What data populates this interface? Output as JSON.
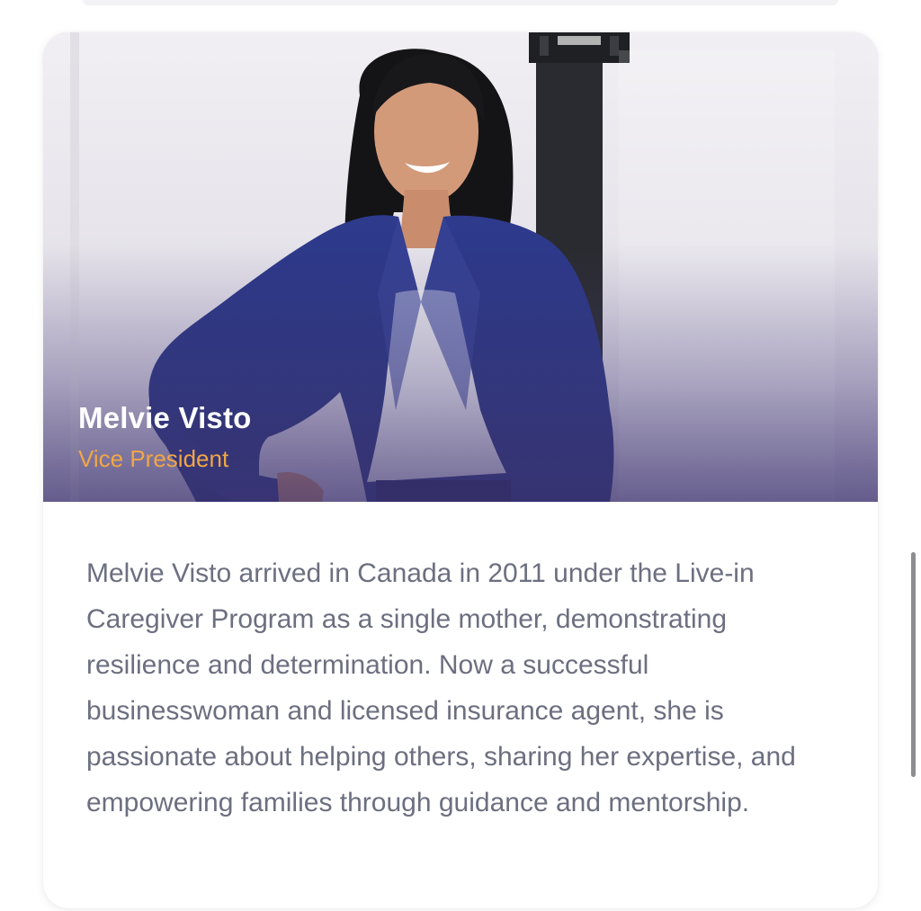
{
  "profile": {
    "name": "Melvie Visto",
    "title": "Vice President",
    "bio": "Melvie Visto arrived in Canada in 2011 under the Live-in Caregiver Program as a single mother, demonstrating resilience and determination. Now a successful businesswoman and licensed insurance agent, she is passionate about helping others, sharing her expertise, and empowering families through guidance and mentorship."
  },
  "colors": {
    "name_text": "#ffffff",
    "title_accent": "#f1a646",
    "bio_text": "#6c6f80",
    "hero_overlay": "#3e3470"
  }
}
